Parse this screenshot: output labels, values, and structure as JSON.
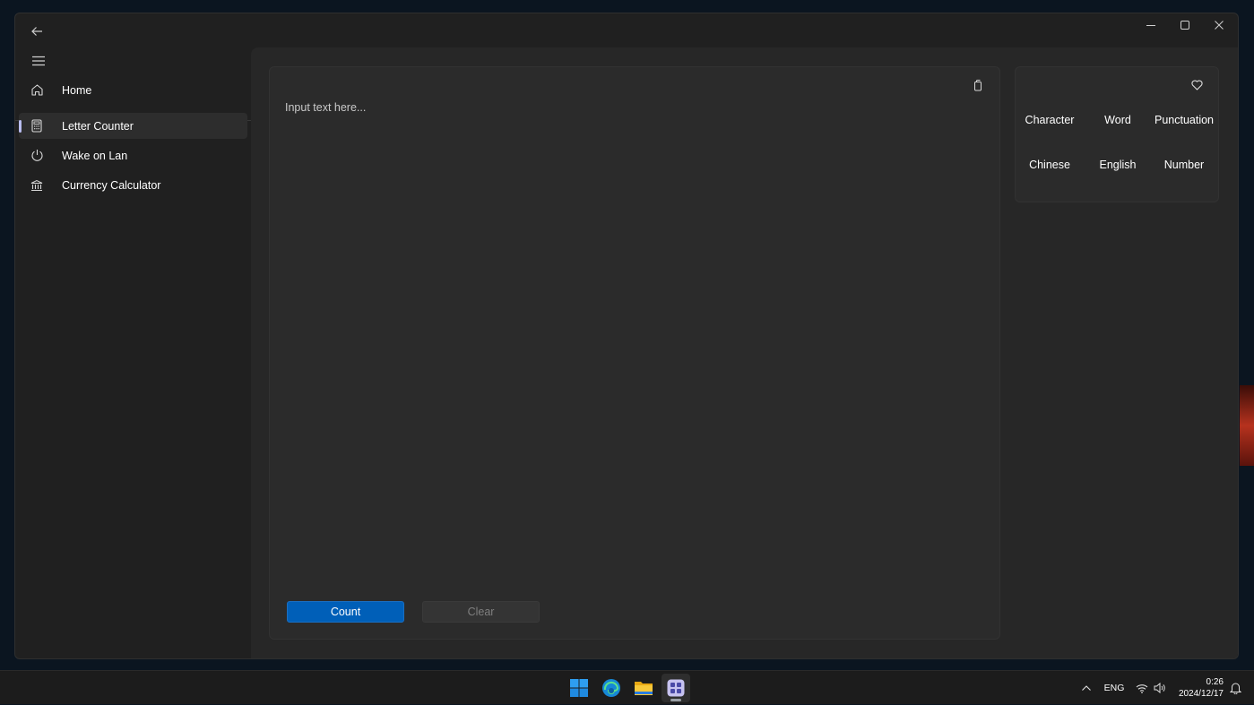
{
  "window": {
    "back_icon": "back-arrow-icon",
    "controls": {
      "minimize_icon": "minimize-icon",
      "maximize_icon": "maximize-icon",
      "close_icon": "close-icon"
    }
  },
  "nav": {
    "menu_icon": "hamburger-menu-icon",
    "home": {
      "label": "Home",
      "icon": "home-icon"
    },
    "items": [
      {
        "label": "Letter Counter",
        "icon": "calculator-icon",
        "selected": true
      },
      {
        "label": "Wake on Lan",
        "icon": "power-icon",
        "selected": false
      },
      {
        "label": "Currency Calculator",
        "icon": "bank-icon",
        "selected": false
      }
    ],
    "selection_color": "#b9bdf0"
  },
  "editor": {
    "placeholder": "Input text here...",
    "value": "",
    "copy_icon": "copy-icon",
    "count_label": "Count",
    "clear_label": "Clear",
    "accent_color": "#005fb8"
  },
  "stats": {
    "favorite_icon": "heart-icon",
    "labels": [
      "Character",
      "Word",
      "Punctuation",
      "Chinese",
      "English",
      "Number"
    ]
  },
  "taskbar": {
    "apps": [
      {
        "name": "start-icon",
        "active": false
      },
      {
        "name": "edge-icon",
        "active": false
      },
      {
        "name": "file-explorer-icon",
        "active": false
      },
      {
        "name": "toolbox-app-icon",
        "active": true
      }
    ],
    "tray": {
      "chevron_icon": "chevron-up-icon",
      "language": "ENG",
      "wifi_icon": "wifi-icon",
      "volume_icon": "volume-icon",
      "time": "0:26",
      "date": "2024/12/17",
      "notification_icon": "notification-icon"
    }
  }
}
